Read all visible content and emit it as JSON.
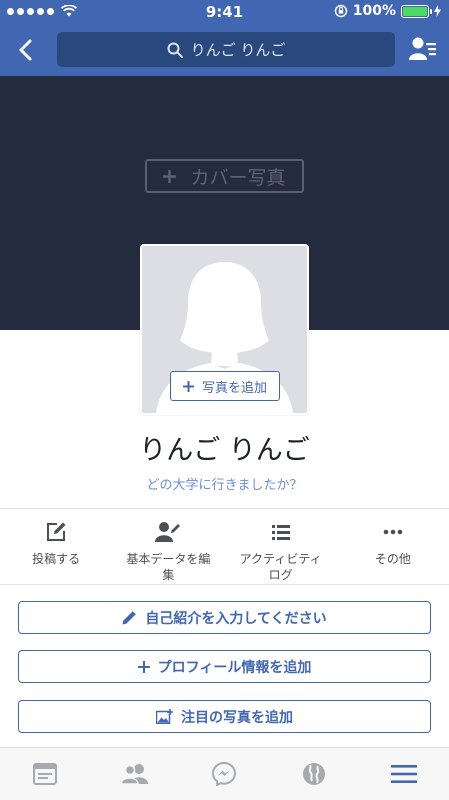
{
  "status_bar": {
    "time": "9:41",
    "battery_percent": "100%",
    "battery_level": 1.0
  },
  "nav": {
    "search_text": "りんご りんご"
  },
  "cover": {
    "button_label": "カバー写真"
  },
  "avatar": {
    "add_photo_label": "写真を追加"
  },
  "profile": {
    "name": "りんご りんご",
    "university_prompt": "どの大学に行きましたか？"
  },
  "actions": [
    {
      "label": "投稿する",
      "icon": "compose-icon"
    },
    {
      "label": "基本データを編\n集",
      "icon": "edit-person-icon"
    },
    {
      "label": "アクティビティ\nログ",
      "icon": "list-icon"
    },
    {
      "label": "その他",
      "icon": "more-icon"
    }
  ],
  "buttons": {
    "intro": "自己紹介を入力してください",
    "profile_info": "プロフィール情報を追加",
    "featured_photos": "注目の写真を追加"
  },
  "tabs": [
    "news-feed-icon",
    "friends-icon",
    "messenger-icon",
    "notifications-globe-icon",
    "menu-icon"
  ],
  "colors": {
    "brand": "#4267b2",
    "cover": "#252b3e",
    "link": "#6b8ed6"
  }
}
